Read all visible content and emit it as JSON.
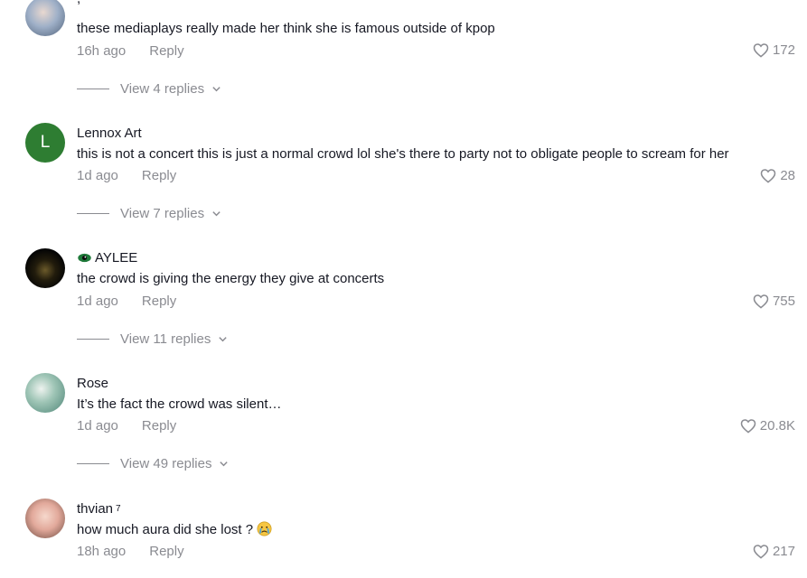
{
  "comments": [
    {
      "username": ",",
      "text": "these mediaplays really made her think she is famous outside of kpop",
      "time": "16h ago",
      "reply_label": "Reply",
      "likes": "172",
      "view_replies": "View 4 replies"
    },
    {
      "username": "Lennox Art",
      "avatar_letter": "L",
      "text": "this is not a concert this is just a normal crowd lol she's there to party not to obligate people to scream for her",
      "time": "1d ago",
      "reply_label": "Reply",
      "likes": "28",
      "view_replies": "View 7 replies"
    },
    {
      "username": "AYLEE",
      "text": "the crowd is giving the energy they give at concerts",
      "time": "1d ago",
      "reply_label": "Reply",
      "likes": "755",
      "view_replies": "View 11 replies"
    },
    {
      "username": "Rose",
      "text": "It’s the fact the crowd was silent…",
      "time": "1d ago",
      "reply_label": "Reply",
      "likes": "20.8K",
      "view_replies": "View 49 replies"
    },
    {
      "username": "thvian",
      "username_sup": "7",
      "text": "how much aura did she lost ?",
      "time": "18h ago",
      "reply_label": "Reply",
      "likes": "217"
    }
  ],
  "icons": {
    "like": "heart-outline-icon",
    "expand": "chevron-down-icon",
    "username_prefix_c3": "green-eye-emoji-icon",
    "text_suffix_c5": "crying-face-emoji-icon"
  },
  "colors": {
    "text": "#161823",
    "secondary": "#8a8b91",
    "avatar_green": "#2e7d32"
  }
}
